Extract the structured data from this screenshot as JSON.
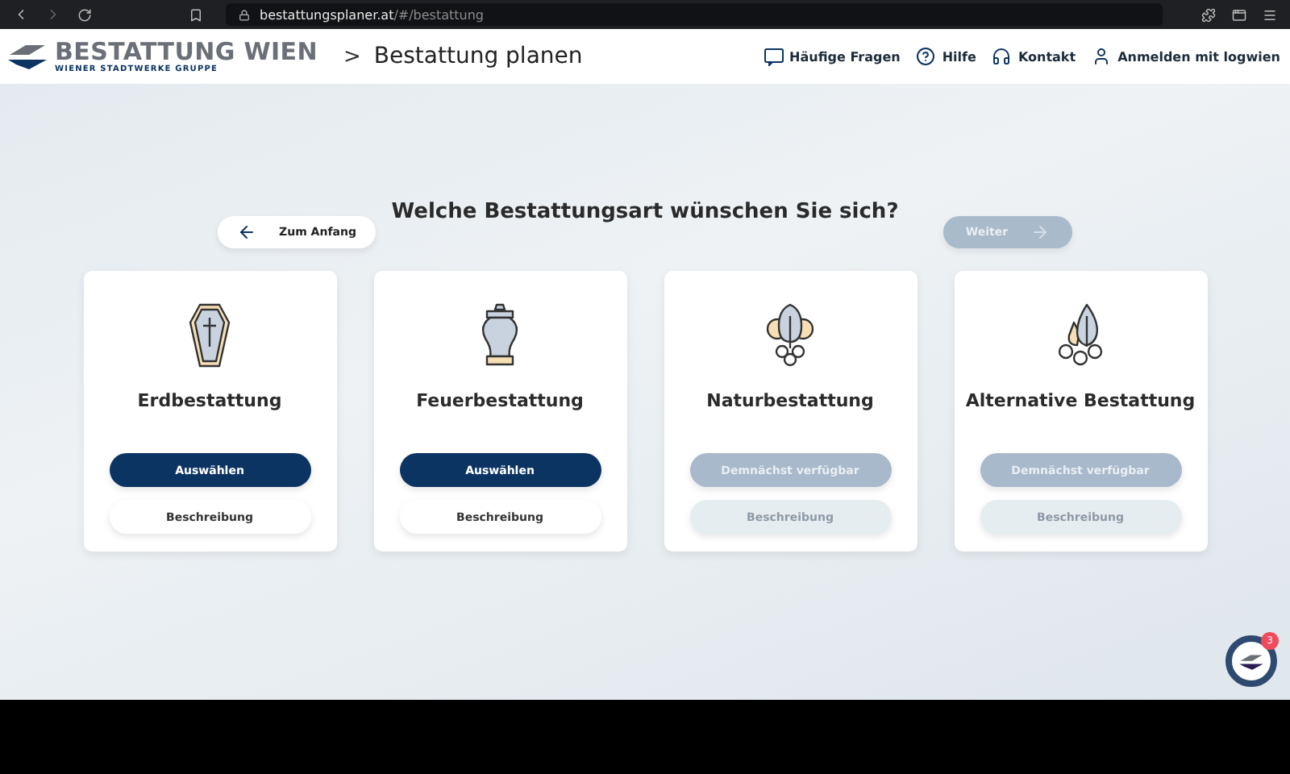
{
  "browser": {
    "url_host": "bestattungsplaner.at",
    "url_path": "/#/bestattung"
  },
  "header": {
    "logo_name": "BESTATTUNG WIEN",
    "logo_sub": "WIENER STADTWERKE GRUPPE",
    "breadcrumb_sep": ">",
    "page_title": "Bestattung planen",
    "links": [
      {
        "kind": "faq",
        "label": "Häufige Fragen"
      },
      {
        "kind": "help",
        "label": "Hilfe"
      },
      {
        "kind": "contact",
        "label": "Kontakt"
      },
      {
        "kind": "user",
        "label": "Anmelden mit logwien"
      }
    ]
  },
  "question": "Welche Bestattungsart wünschen Sie sich?",
  "back_button": {
    "label": "Zum Anfang"
  },
  "next_button": {
    "label": "Weiter",
    "disabled": true
  },
  "options": [
    {
      "kind": "coffin",
      "title": "Erdbestattung",
      "primary": "Auswählen",
      "secondary": "Beschreibung",
      "disabled": false
    },
    {
      "kind": "urn",
      "title": "Feuerbestattung",
      "primary": "Auswählen",
      "secondary": "Beschreibung",
      "disabled": false
    },
    {
      "kind": "tree",
      "title": "Naturbestattung",
      "primary": "Demnächst verfügbar",
      "secondary": "Beschreibung",
      "disabled": true
    },
    {
      "kind": "flowers",
      "title": "Alternative Bestattung",
      "primary": "Demnächst verfügbar",
      "secondary": "Beschreibung",
      "disabled": true
    }
  ],
  "chat": {
    "badge": "3"
  }
}
